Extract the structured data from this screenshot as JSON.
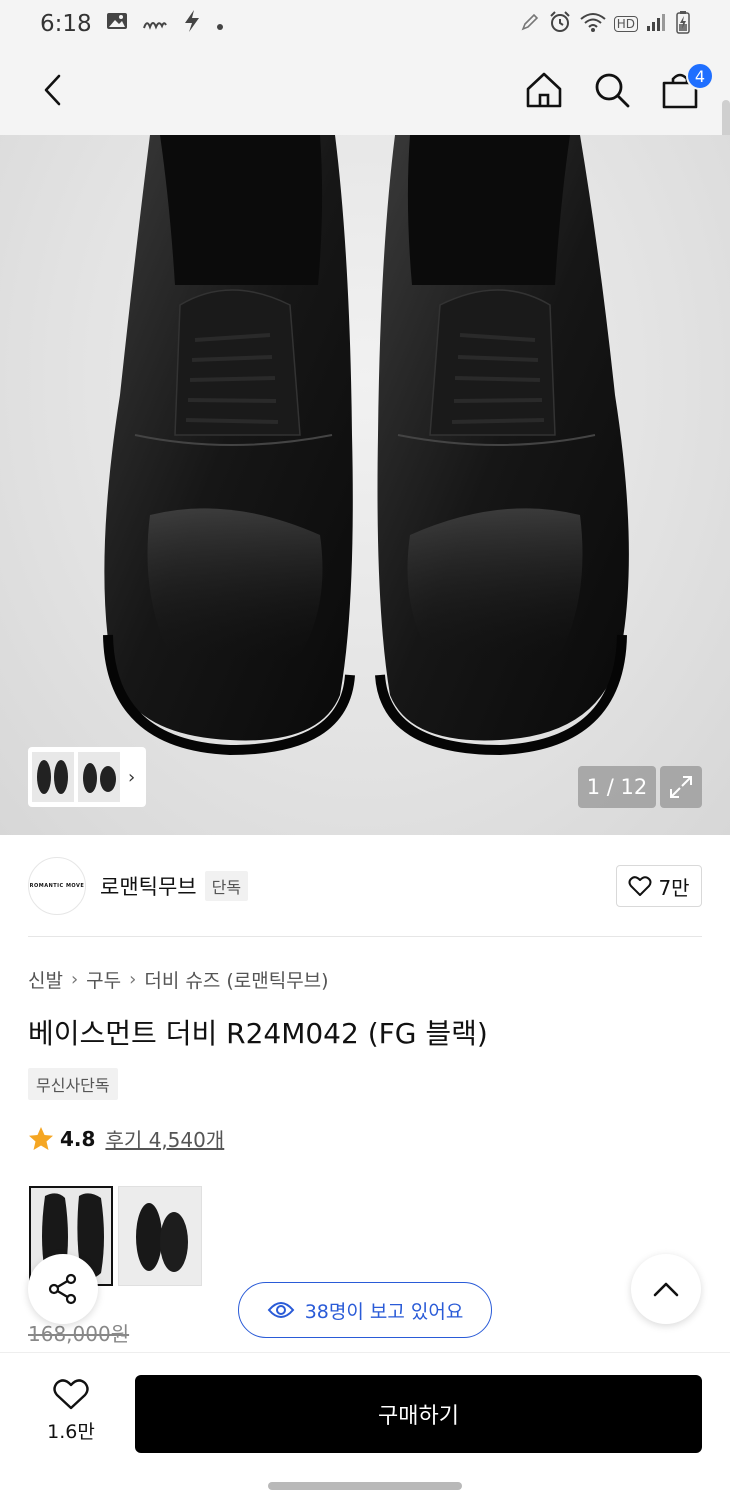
{
  "status_bar": {
    "time": "6:18",
    "net_label": "HD"
  },
  "header": {
    "cart_count": "4"
  },
  "gallery": {
    "counter": "1 / 12"
  },
  "brand": {
    "name": "로맨틱무브",
    "tag": "단독",
    "likes": "7만",
    "logo_text": "ROMANTIC MOVE"
  },
  "breadcrumb": [
    "신발",
    "구두",
    "더비 슈즈 (로맨틱무브)"
  ],
  "product": {
    "title": "베이스먼트 더비 R24M042 (FG 블랙)",
    "badge": "무신사단독",
    "rating": "4.8",
    "reviews": "후기 4,540개",
    "original_price": "168,000원",
    "viewers": "38명이 보고 있어요"
  },
  "bottom": {
    "wish_count": "1.6만",
    "buy_label": "구매하기"
  },
  "colors": {
    "accent_blue": "#2a5bd7",
    "badge_blue": "#1f6fff",
    "star": "#f5a623",
    "buy": "#000000"
  }
}
